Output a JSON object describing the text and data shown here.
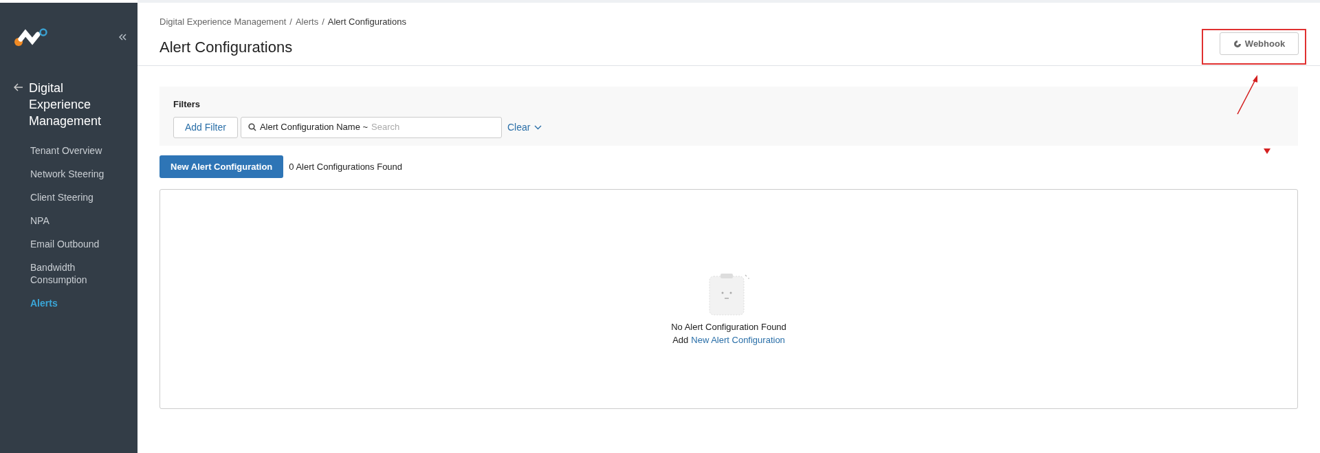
{
  "sidebar": {
    "section_title": "Digital Experience Management",
    "items": [
      {
        "label": "Tenant Overview",
        "selected": false
      },
      {
        "label": "Network Steering",
        "selected": false
      },
      {
        "label": "Client Steering",
        "selected": false
      },
      {
        "label": "NPA",
        "selected": false
      },
      {
        "label": "Email Outbound",
        "selected": false
      },
      {
        "label": "Bandwidth Consumption",
        "selected": false
      },
      {
        "label": "Alerts",
        "selected": true
      }
    ]
  },
  "breadcrumb": [
    {
      "kind": "link",
      "text": "Digital Experience Management"
    },
    {
      "kind": "separator",
      "text": "/"
    },
    {
      "kind": "link",
      "text": "Alerts"
    },
    {
      "kind": "separator",
      "text": "/"
    },
    {
      "kind": "current",
      "text": "Alert Configurations"
    }
  ],
  "page_title": "Alert Configurations",
  "webhook_button": "Webhook",
  "filters": {
    "title": "Filters",
    "add_filter": "Add Filter",
    "search_label": "Alert Configuration Name ~",
    "search_placeholder": "Search",
    "clear": "Clear"
  },
  "new_button": "New Alert Configuration",
  "count_text": "0 Alert Configurations Found",
  "empty_state": {
    "message": "No Alert Configuration Found",
    "prefix": "Add",
    "link": "New Alert Configuration"
  }
}
